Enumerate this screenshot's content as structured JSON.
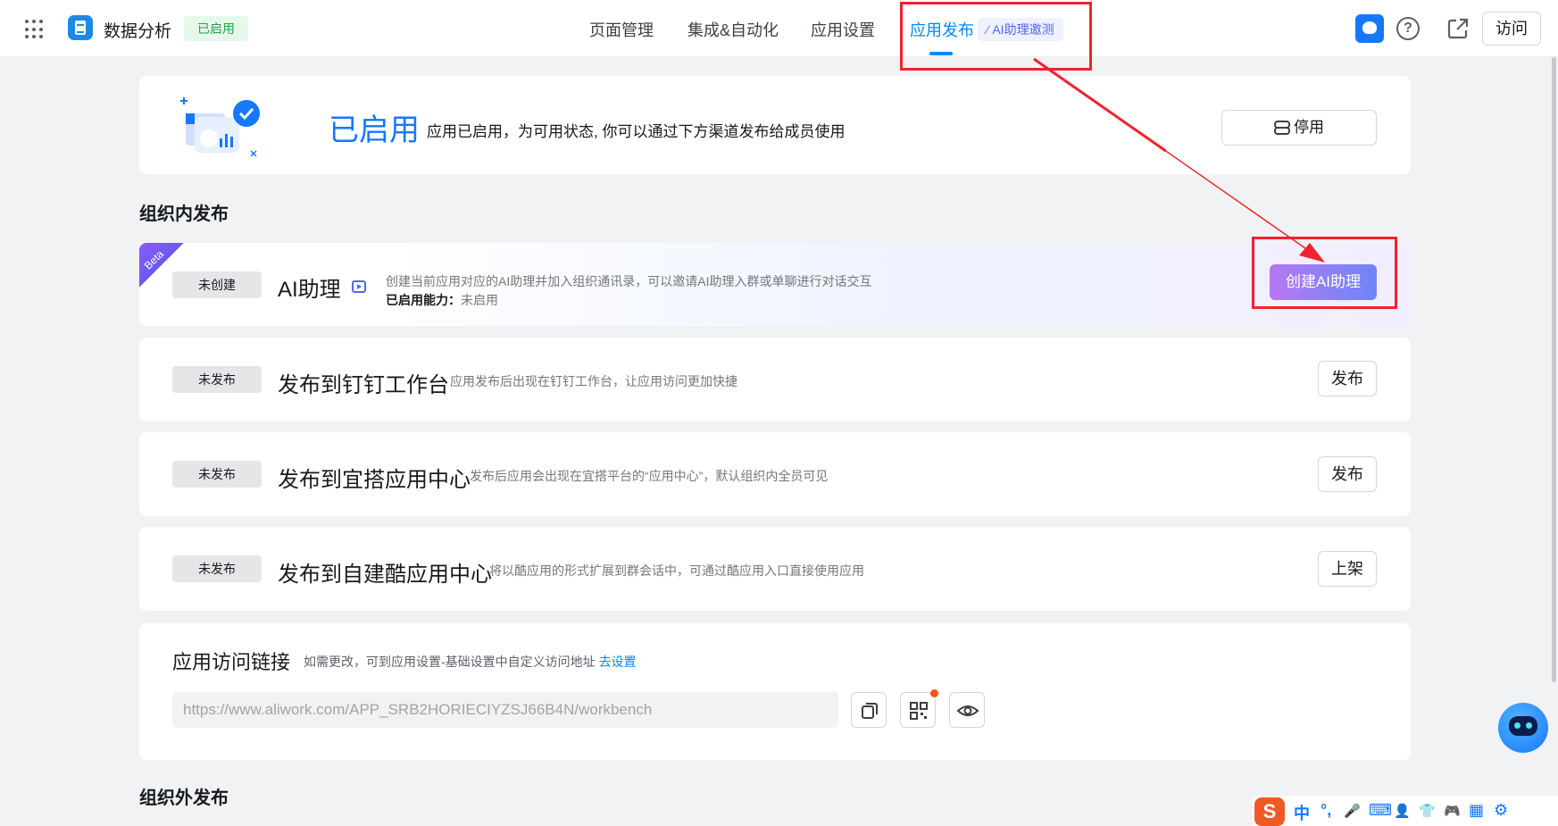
{
  "header": {
    "app_name": "数据分析",
    "status_tag": "已启用",
    "nav": [
      "页面管理",
      "集成&自动化",
      "应用设置",
      "应用发布"
    ],
    "ai_pill": "AI助理邀测",
    "help_icon_text": "?",
    "visit_label": "访问"
  },
  "hero": {
    "title": "已启用",
    "desc": "应用已启用，为可用状态, 你可以通过下方渠道发布给成员使用",
    "stop_label": "停用"
  },
  "section_internal": "组织内发布",
  "section_external": "组织外发布",
  "ai_assistant": {
    "ribbon": "Beta",
    "status": "未创建",
    "title": "AI助理",
    "desc": "创建当前应用对应的AI助理并加入组织通讯录，可以邀请AI助理入群或单聊进行对话交互",
    "capability_label": "已启用能力：",
    "capability_value": "未启用",
    "button": "创建AI助理"
  },
  "channels": [
    {
      "status": "未发布",
      "title": "发布到钉钉工作台",
      "desc": "应用发布后出现在钉钉工作台，让应用访问更加快捷",
      "button": "发布"
    },
    {
      "status": "未发布",
      "title": "发布到宜搭应用中心",
      "desc": "发布后应用会出现在宜搭平台的“应用中心”，默认组织内全员可见",
      "button": "发布"
    },
    {
      "status": "未发布",
      "title": "发布到自建酷应用中心",
      "desc": "将以酷应用的形式扩展到群会话中，可通过酷应用入口直接使用应用",
      "button": "上架"
    }
  ],
  "link": {
    "title": "应用访问链接",
    "hint": "如需更改，可到应用设置-基础设置中自定义访问地址",
    "hint_link": "去设置",
    "url": "https://www.aliwork.com/APP_SRB2HORIECIYZSJ66B4N/workbench"
  },
  "ime": {
    "logo": "S",
    "items": [
      "中",
      "°,",
      "🎤",
      "⌨",
      "👤",
      "👕",
      "🎮",
      "▦",
      "⚙"
    ]
  },
  "colors": {
    "accent": "#0089ff",
    "annotation_red": "#f0232d",
    "success": "#23a148"
  }
}
